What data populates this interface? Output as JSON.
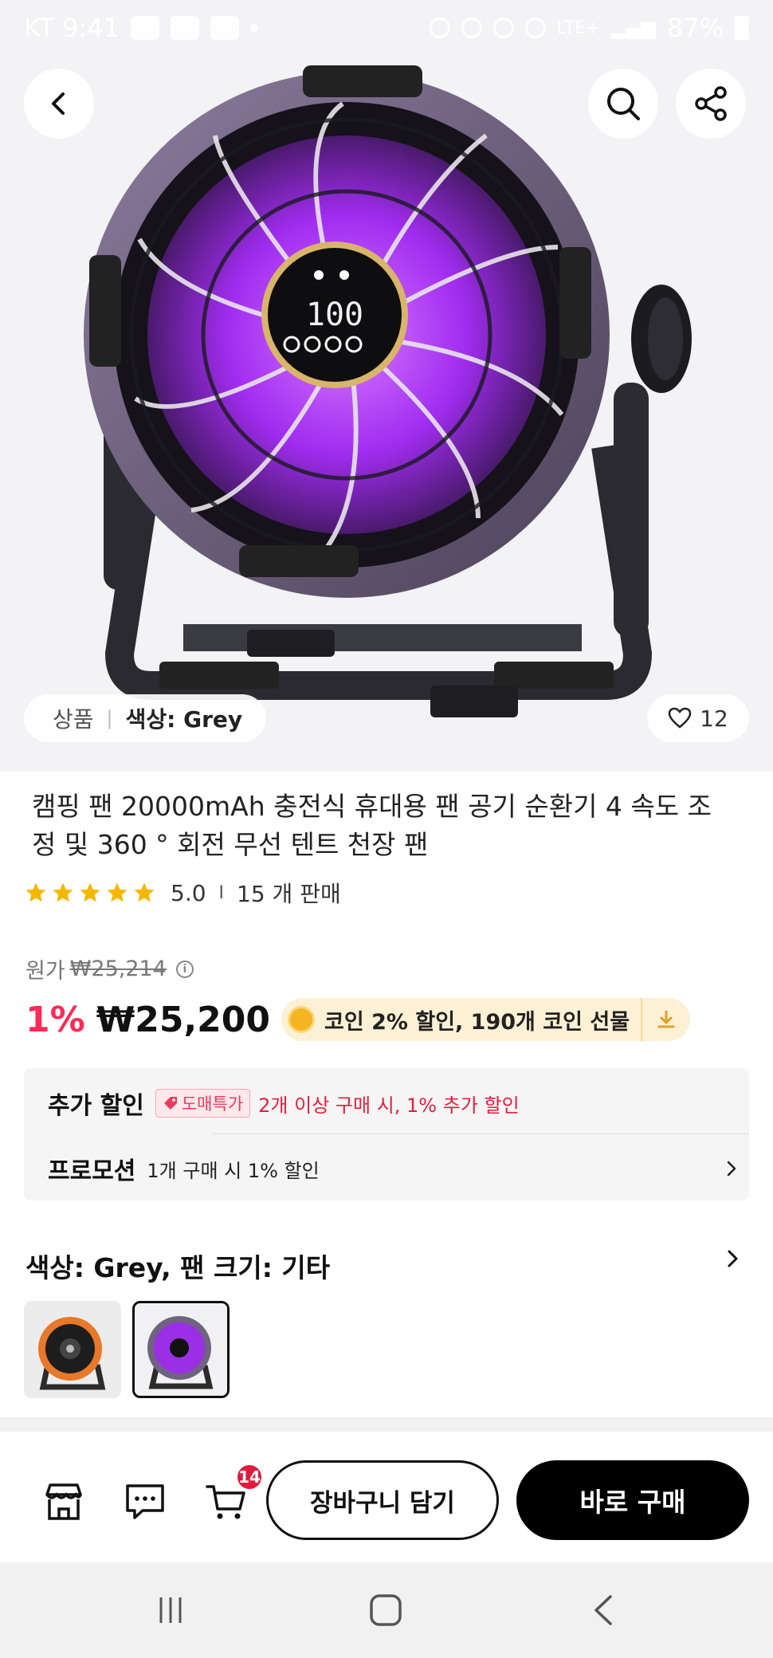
{
  "status_bar": {
    "carrier_time": "KT 9:41",
    "network": "LTE+",
    "battery": "87%"
  },
  "hero": {
    "product_image": "purple-camping-fan",
    "variant_chip": {
      "label": "상품",
      "separator": "|",
      "value": "색상: Grey"
    },
    "likes": "12"
  },
  "product": {
    "title": "캠핑 팬 20000mAh 충전식 휴대용 팬 공기 순환기 4 속도 조정 및 360 ° 회전 무선 텐트 천장 팬",
    "rating": "5.0",
    "rating_divider": "I",
    "sold": "15 개 판매",
    "stars": 5,
    "star_color": "#f5b800"
  },
  "price": {
    "original_label": "원가",
    "original_value": "₩25,214",
    "discount": "1%",
    "current": "₩25,200",
    "coin_text": "코인 2% 할인,  190개 코인 선물",
    "discount_color": "#ff2a55"
  },
  "promotions": {
    "extra_label": "추가 할인",
    "wholesale_badge": "도매특가",
    "extra_text": "2개 이상 구매 시, 1% 추가 할인",
    "promo_label": "프로모션",
    "promo_text": "1개 구매 시 1% 할인"
  },
  "variant": {
    "title": "색상: Grey, 팬 크기: 기타",
    "options": [
      "orange-fan-thumbnail",
      "purple-fan-thumbnail"
    ],
    "selected_index": 1
  },
  "actions": {
    "cart_count": "14",
    "add_to_cart": "장바구니 담기",
    "buy_now": "바로 구매"
  }
}
